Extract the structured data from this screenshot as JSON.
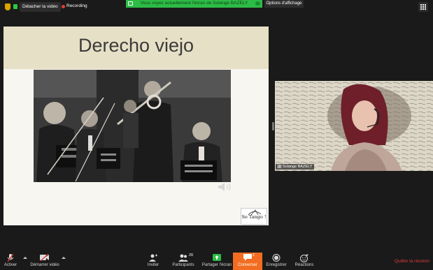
{
  "topbar": {
    "detach_label": "Détacher la vidéo",
    "recording_label": "Recording",
    "banner_text": "Vous voyez actuellement l'écran de Solange BAZELY",
    "view_options_label": "Options d'affichage"
  },
  "slide": {
    "title": "Derecho viejo",
    "logo_text": "So Tango !"
  },
  "video": {
    "participant_name": "Solange BAZELY"
  },
  "toolbar": {
    "mute_label": "Activer",
    "video_label": "Démarrer vidéo",
    "invite_label": "Inviter",
    "participants_label": "Participants",
    "participants_count": "20",
    "share_label": "Partager l'écran",
    "chat_label": "Converser",
    "chat_count": "2",
    "record_label": "Enregistrer",
    "reactions_label": "Réactions",
    "leave_label": "Quitter la réunion"
  },
  "colors": {
    "banner_green": "#2dbc46",
    "chat_accent": "#f26d21",
    "leave_red": "#e23b3b",
    "slide_header": "#e6e0c6"
  }
}
